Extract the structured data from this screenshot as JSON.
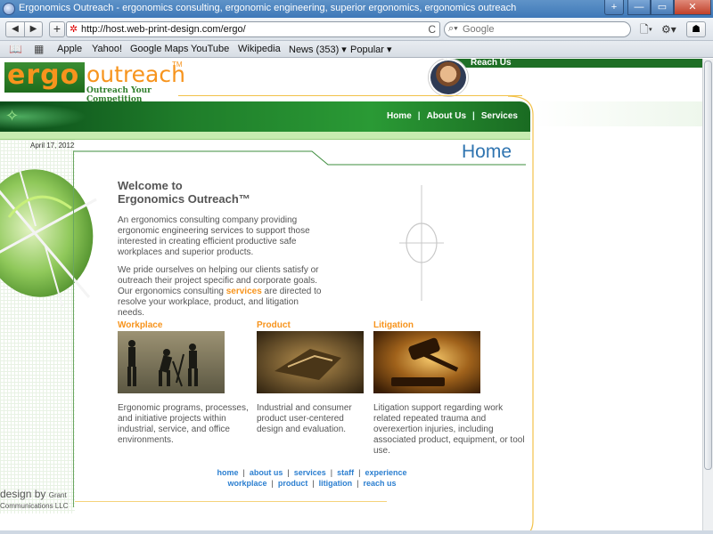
{
  "browser": {
    "window_title": "Ergonomics Outreach - ergonomics consulting, ergonomic engineering, superior ergonomics, ergonomics outreach",
    "url": "http://host.web-print-design.com/ergo/",
    "search_placeholder": "Google",
    "bookmarks": [
      "Apple",
      "Yahoo!",
      "Google Maps",
      "YouTube",
      "Wikipedia",
      "News (353) ▾",
      "Popular ▾"
    ],
    "nav_back": "◀",
    "nav_forward": "▶",
    "plus": "+",
    "reload": "C",
    "window_buttons": {
      "newtab": "+",
      "minimize": "—",
      "maximize": "▭",
      "close": "✕"
    }
  },
  "header": {
    "logo_ergo": "ergo",
    "logo_outreach": "outreach",
    "logo_tm": "TM",
    "tagline": "Outreach Your Competition",
    "reach_us": "Reach Us"
  },
  "nav": {
    "items": [
      "Home",
      "About Us",
      "Services"
    ]
  },
  "page": {
    "date": "April 17, 2012",
    "heading": "Home",
    "welcome_line1": "Welcome to",
    "welcome_line2": "Ergonomics Outreach™",
    "intro": "An ergonomics consulting company providing ergonomic engineering services to support those interested in creating efficient productive safe workplaces and superior products.",
    "intro2_before": "We pride ourselves on helping our clients satisfy or outreach their project specific and corporate goals. Our ergonomics consulting ",
    "intro2_link": "services",
    "intro2_after": " are directed to resolve your workplace, product, and litigation needs."
  },
  "sections": [
    {
      "title": "Workplace",
      "text": "Ergonomic programs, processes, and initiative projects within industrial, service, and office environments."
    },
    {
      "title": "Product",
      "text": "Industrial and consumer product user-centered design and evaluation."
    },
    {
      "title": "Litigation",
      "text": "Litigation support regarding work related repeated trauma and overexertion injuries, including associated product, equipment, or tool use."
    }
  ],
  "footer": {
    "row1": [
      "home",
      "about us",
      "services",
      "staff",
      "experience"
    ],
    "row2": [
      "workplace",
      "product",
      "litigation",
      "reach us"
    ],
    "credit_main": "design by",
    "credit_grant": "Grant",
    "credit_line2": "Communications LLC"
  },
  "colors": {
    "accent_orange": "#f7941d",
    "brand_green": "#1f7d2a",
    "link_blue": "#2c7fd0",
    "heading_blue": "#2f74b0"
  }
}
